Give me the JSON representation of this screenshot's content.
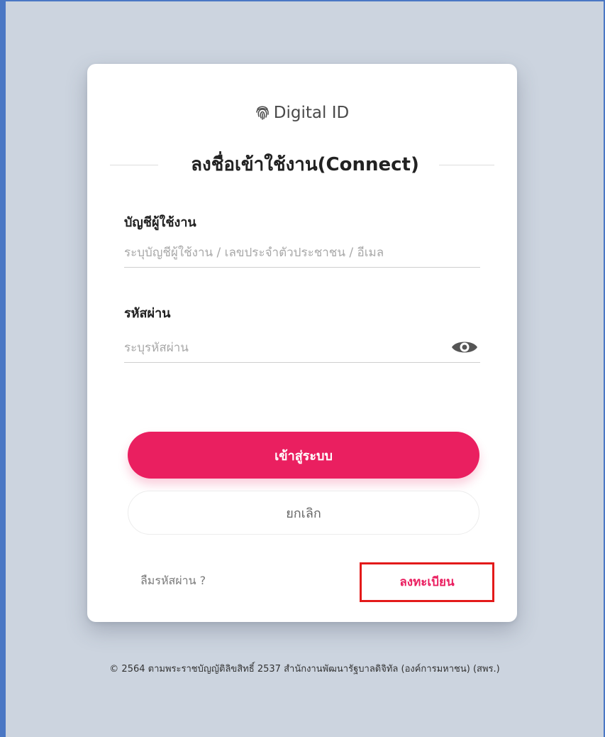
{
  "brand": {
    "name": "Digital ID",
    "icon": "fingerprint-icon"
  },
  "form": {
    "title": "ลงชื่อเข้าใช้งาน(Connect)",
    "username": {
      "label": "บัญชีผู้ใช้งาน",
      "placeholder": "ระบุบัญชีผู้ใช้งาน / เลขประจำตัวประชาชน / อีเมล",
      "value": ""
    },
    "password": {
      "label": "รหัสผ่าน",
      "placeholder": "ระบุรหัสผ่าน",
      "value": "",
      "toggle_icon": "eye-icon"
    },
    "login_label": "เข้าสู่ระบบ",
    "cancel_label": "ยกเลิก",
    "forgot_label": "ลืมรหัสผ่าน ?",
    "register_label": "ลงทะเบียน"
  },
  "footer": {
    "text": "© 2564 ตามพระราชบัญญัติลิขสิทธิ์ 2537 สำนักงานพัฒนารัฐบาลดิจิทัล (องค์การมหาชน) (สพร.)"
  },
  "colors": {
    "page_background": "#ccd4df",
    "window_border": "#4a77c4",
    "primary": "#ea1f60",
    "highlight_box": "#e31a1a"
  }
}
